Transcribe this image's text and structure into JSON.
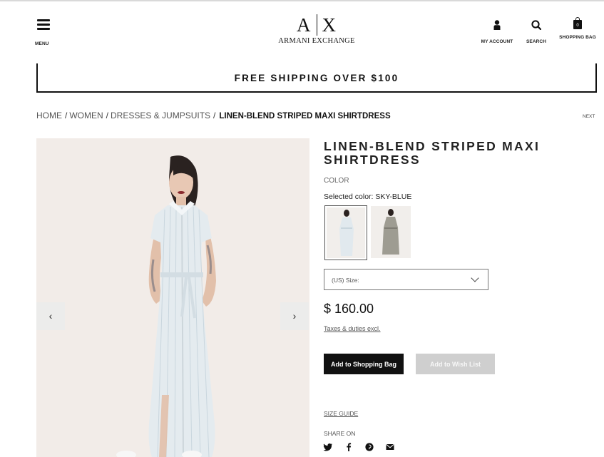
{
  "header": {
    "menu_label": "MENU",
    "logo_mark_left": "A",
    "logo_mark_right": "X",
    "logo_text": "ARMANI EXCHANGE",
    "account_label": "MY ACCOUNT",
    "search_label": "SEARCH",
    "bag_label": "SHOPPING BAG",
    "bag_count": "0"
  },
  "banner": {
    "text": "FREE SHIPPING OVER $100"
  },
  "breadcrumb": {
    "items": [
      "HOME",
      "WOMEN",
      "DRESSES & JUMPSUITS"
    ],
    "current": "LINEN-BLEND STRIPED MAXI SHIRTDRESS",
    "separator": "/",
    "next_label": "NEXT"
  },
  "gallery": {
    "prev_icon": "chevron-left-icon",
    "next_icon": "chevron-right-icon"
  },
  "product": {
    "title": "LINEN-BLEND STRIPED MAXI SHIRTDRESS",
    "color_label": "COLOR",
    "selected_color": "Selected color: SKY-BLUE",
    "swatches": [
      "sky-blue",
      "grey"
    ],
    "size_placeholder": "(US) Size:",
    "price": "$ 160.00",
    "taxes_note": "Taxes & duties excl.",
    "add_to_bag": "Add to Shopping Bag",
    "add_to_wishlist": "Add to Wish List",
    "size_guide": "SIZE GUIDE",
    "share_label": "SHARE ON",
    "share_icons": [
      "twitter-icon",
      "facebook-icon",
      "pinterest-icon",
      "mail-icon"
    ]
  },
  "colors": {
    "accent": "#111111",
    "image_bg": "#f2ece8",
    "wishlist_bg": "#cfcfcf",
    "dress_blue": "#dfe7ec"
  }
}
